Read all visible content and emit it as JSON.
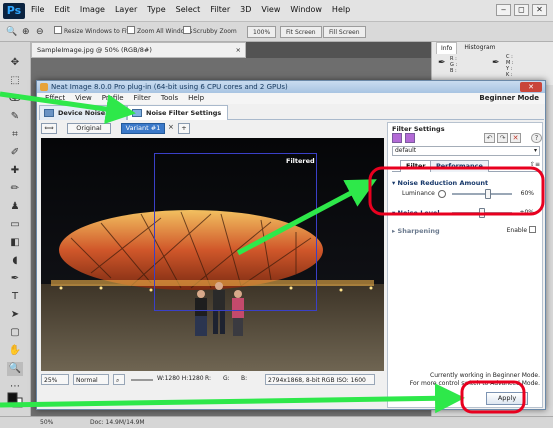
{
  "photoshop": {
    "logo": "Ps",
    "menu": [
      "File",
      "Edit",
      "Image",
      "Layer",
      "Type",
      "Select",
      "Filter",
      "3D",
      "View",
      "Window",
      "Help"
    ],
    "options": {
      "resize_windows": "Resize Windows to Fit",
      "zoom_all": "Zoom All Windows",
      "scrubby_zoom": "Scrubby Zoom",
      "zoom_100": "100%",
      "fit_screen": "Fit Screen",
      "fill_screen": "Fill Screen"
    },
    "doc_tab": "SampleImage.jpg @ 50% (RGB/8#)",
    "panel_tabs": [
      "Info",
      "Histogram"
    ],
    "info_rows": [
      "R :",
      "G :",
      "B :"
    ],
    "info_rows_cmyk": [
      "C :",
      "M :",
      "Y :",
      "K :"
    ],
    "status": {
      "zoom": "50%",
      "doc": "Doc: 14.9M/14.9M"
    }
  },
  "neat_image": {
    "title": "Neat Image 8.0.0 Pro plug-in (64-bit using 6 CPU cores and 2 GPUs)",
    "menu": [
      "Effect",
      "View",
      "Profile",
      "Filter",
      "Tools",
      "Help"
    ],
    "mode": "Beginner Mode",
    "tabs": {
      "device_noise": "Device Noise Pro",
      "noise_filter": "Noise Filter Settings"
    },
    "view": {
      "original": "Original",
      "variant": "Variant #1",
      "plus": "+"
    },
    "image": {
      "overlay_label": "Filtered"
    },
    "bottom": {
      "zoom": "25%",
      "mode": "Normal",
      "dims": "W:1280 H:1280",
      "r": "R:",
      "g": "G:",
      "b": "B:",
      "info": "2794x1868, 8-bit RGB  ISO: 1600"
    },
    "settings": {
      "title": "Filter Settings",
      "preset": "default",
      "tab_filter": "Filter",
      "tab_performance": "Performance",
      "section_reduction": "Noise Reduction Amount",
      "luminance_label": "Luminance",
      "luminance_value": "60%",
      "luminance_level": 0.6,
      "section_level": "Noise Level",
      "level_value": "+0%",
      "level_level": 0.5,
      "section_sharpening": "Sharpening",
      "enable_label": "Enable",
      "note_line1": "Currently working in Beginner Mode.",
      "note_line2": "For more control switch to Advanced Mode.",
      "apply": "Apply"
    }
  },
  "colors": {
    "annotation_arrow": "#2ee84a",
    "annotation_ring": "#e8001f"
  }
}
